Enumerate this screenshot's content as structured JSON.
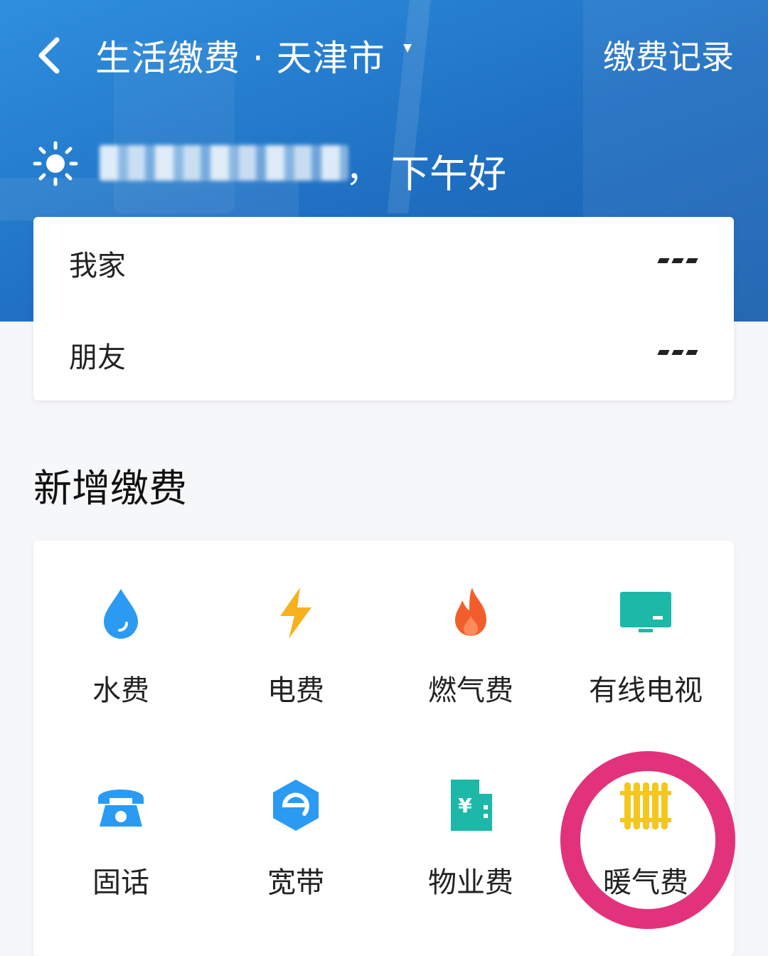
{
  "header": {
    "back_icon": "chevron-left-icon",
    "title": "生活缴费 · 天津市",
    "city_caret_icon": "caret-down-icon",
    "records_label": "缴费记录"
  },
  "greeting": {
    "weather_icon": "sun-icon",
    "name_blurred": true,
    "comma": "，",
    "text": "下午好"
  },
  "accounts": [
    {
      "name": "我家",
      "more_icon": "more-icon"
    },
    {
      "name": "朋友",
      "more_icon": "more-icon"
    }
  ],
  "new_payment": {
    "title": "新增缴费",
    "services": [
      {
        "label": "水费",
        "icon": "water-drop-icon",
        "color": "#2b9af3"
      },
      {
        "label": "电费",
        "icon": "lightning-icon",
        "color": "#f5b21d"
      },
      {
        "label": "燃气费",
        "icon": "flame-icon",
        "color": "#f25e2b"
      },
      {
        "label": "有线电视",
        "icon": "tv-icon",
        "color": "#1cb8a8"
      },
      {
        "label": "固话",
        "icon": "telephone-icon",
        "color": "#2b9af3"
      },
      {
        "label": "宽带",
        "icon": "broadband-icon",
        "color": "#2b9af3"
      },
      {
        "label": "物业费",
        "icon": "building-icon",
        "color": "#1cb8a8"
      },
      {
        "label": "暖气费",
        "icon": "radiator-icon",
        "color": "#f5c61d"
      }
    ]
  },
  "annotation": {
    "highlight_color": "#e2327b"
  }
}
